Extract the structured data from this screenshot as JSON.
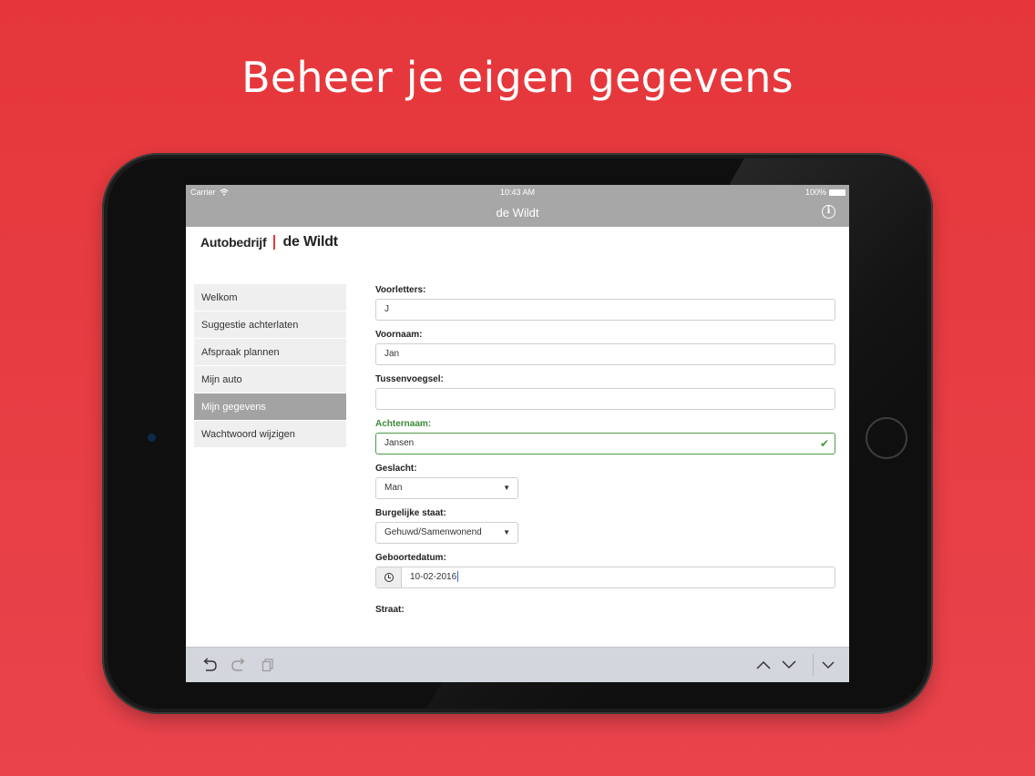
{
  "headline": "Beheer je eigen gegevens",
  "status_bar": {
    "carrier": "Carrier",
    "time": "10:43 AM",
    "battery": "100%"
  },
  "navbar": {
    "title": "de Wildt"
  },
  "logo": {
    "part1": "Autobedrijf",
    "part2": "de Wildt"
  },
  "sidebar": {
    "items": [
      {
        "label": "Welkom"
      },
      {
        "label": "Suggestie achterlaten"
      },
      {
        "label": "Afspraak plannen"
      },
      {
        "label": "Mijn auto"
      },
      {
        "label": "Mijn gegevens",
        "active": true
      },
      {
        "label": "Wachtwoord wijzigen"
      }
    ]
  },
  "form": {
    "voorletters": {
      "label": "Voorletters:",
      "value": "J"
    },
    "voornaam": {
      "label": "Voornaam:",
      "value": "Jan"
    },
    "tussenvoegsel": {
      "label": "Tussenvoegsel:",
      "value": ""
    },
    "achternaam": {
      "label": "Achternaam:",
      "value": "Jansen"
    },
    "geslacht": {
      "label": "Geslacht:",
      "value": "Man"
    },
    "burgerlijke_staat": {
      "label": "Burgelijke staat:",
      "value": "Gehuwd/Samenwonend"
    },
    "geboortedatum": {
      "label": "Geboortedatum:",
      "value": "10-02-2016"
    },
    "straat": {
      "label": "Straat:"
    }
  },
  "colors": {
    "background": "#e5373a",
    "navbar": "#a7a7a7",
    "valid": "#3c8a3a",
    "accent": "#e5373a"
  },
  "icons": {
    "undo": "undo-icon",
    "redo": "redo-icon",
    "paste": "paste-icon",
    "previous": "chevron-up-icon",
    "next": "chevron-down-icon",
    "dismiss": "chevron-down-icon"
  }
}
